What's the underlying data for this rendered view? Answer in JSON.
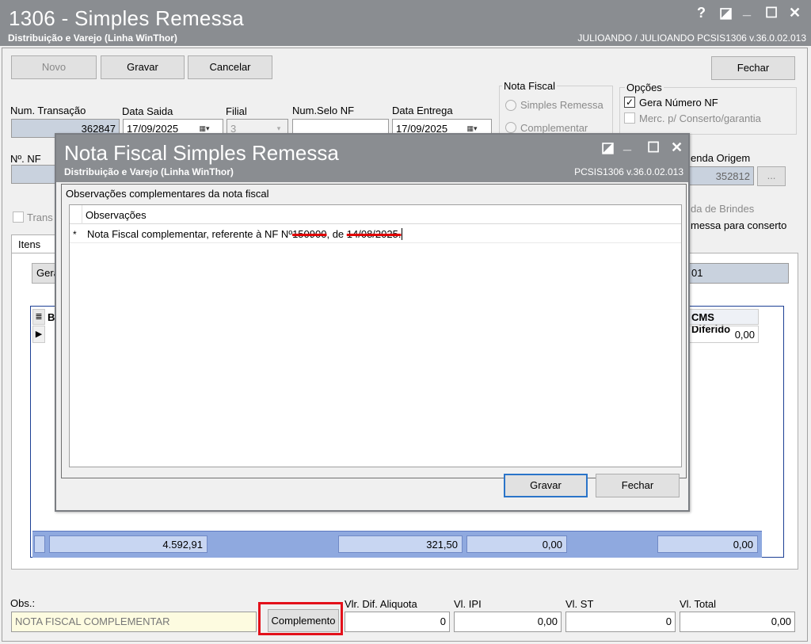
{
  "window": {
    "title": "1306 - Simples Remessa",
    "subtitle": "Distribuição e Varejo (Linha WinThor)",
    "user_version": "JULIOANDO / JULIOANDO   PCSIS1306  v.36.0.02.013",
    "help_glyph": "?",
    "restore_glyph": "◪",
    "minimize_glyph": "_",
    "maximize_glyph": "☐",
    "close_glyph": "✕"
  },
  "toolbar": {
    "novo": "Novo",
    "gravar": "Gravar",
    "cancelar": "Cancelar",
    "fechar": "Fechar"
  },
  "nota_fiscal": {
    "title": "Nota Fiscal",
    "option_simples": "Simples Remessa",
    "option_complementar": "Complementar"
  },
  "opcoes": {
    "title": "Opções",
    "gera_numero": "Gera Número NF",
    "gera_numero_checked": true,
    "merc_conserto": "Merc. p/ Conserto/garantia"
  },
  "form": {
    "num_transacao_label": "Num. Transação",
    "num_transacao_value": "362847",
    "data_saida_label": "Data Saida",
    "data_saida_value": "17/09/2025",
    "filial_label": "Filial",
    "filial_value": "3",
    "num_selo_label": "Num.Selo NF",
    "data_entrega_label": "Data Entrega",
    "data_entrega_value": "17/09/2025",
    "nf_label": "Nº. NF",
    "venda_origem_label": "enda Origem",
    "venda_origem_value": "352812",
    "ellipsis": "...",
    "trans_label": "Trans",
    "brindes_label": "da de Brindes",
    "conserto_label": "messa para conserto",
    "tab_itens": "Itens",
    "gera_button": "Gera",
    "right_field_value": "01",
    "col_b": "B",
    "col_icms_diferido": "CMS Diferido",
    "icms_value": "0,00"
  },
  "totals": {
    "t1": "4.592,91",
    "t2": "321,50",
    "t3": "0,00",
    "t4": "0,00"
  },
  "bottom": {
    "obs_label": "Obs.:",
    "obs_value": "NOTA FISCAL COMPLEMENTAR",
    "complemento_button": "Complemento",
    "vlr_dif_label": "Vlr. Dif. Aliquota",
    "vlr_dif_value": "0",
    "vl_ipi_label": "Vl. IPI",
    "vl_ipi_value": "0,00",
    "vl_st_label": "Vl. ST",
    "vl_st_value": "0",
    "vl_total_label": "Vl. Total",
    "vl_total_value": "0,00"
  },
  "dialog": {
    "title": "Nota Fiscal Simples Remessa",
    "subtitle": "Distribuição e Varejo (Linha WinThor)",
    "version": "PCSIS1306  v.36.0.02.013",
    "group_title": "Observações complementares da nota fiscal",
    "column_header": "Observações",
    "row_marker": "*",
    "row_text_part1": "Nota Fiscal complementar, referente à NF Nº",
    "row_text_nf": "150900",
    "row_text_part2": ", de ",
    "row_text_date": "14/08/2025.",
    "gravar": "Gravar",
    "fechar": "Fechar"
  }
}
